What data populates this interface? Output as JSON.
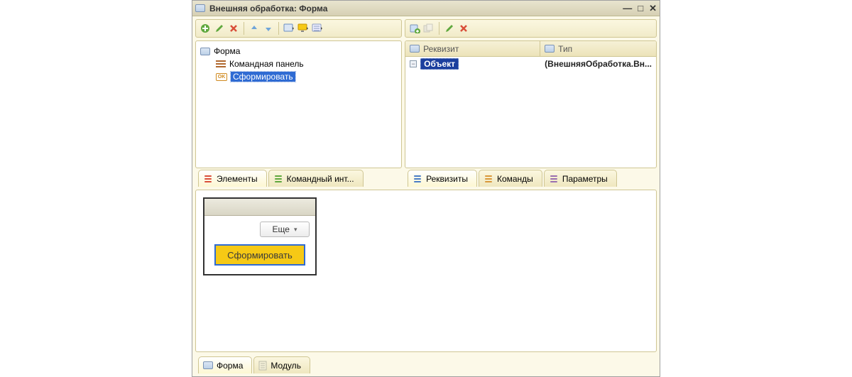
{
  "window": {
    "title": "Внешняя обработка: Форма"
  },
  "left_panel": {
    "tree": {
      "root": "Форма",
      "cmd_panel": "Командная панель",
      "generate": "Сформировать"
    },
    "tabs": {
      "elements": "Элементы",
      "cmd_interface": "Командный инт..."
    }
  },
  "right_panel": {
    "columns": {
      "attribute": "Реквизит",
      "type": "Тип"
    },
    "row": {
      "object": "Объект",
      "type_value": "(ВнешняяОбработка.Вн..."
    },
    "tabs": {
      "attributes": "Реквизиты",
      "commands": "Команды",
      "parameters": "Параметры"
    }
  },
  "preview": {
    "more": "Еще",
    "generate": "Сформировать"
  },
  "bottom_tabs": {
    "form": "Форма",
    "module": "Модуль"
  }
}
